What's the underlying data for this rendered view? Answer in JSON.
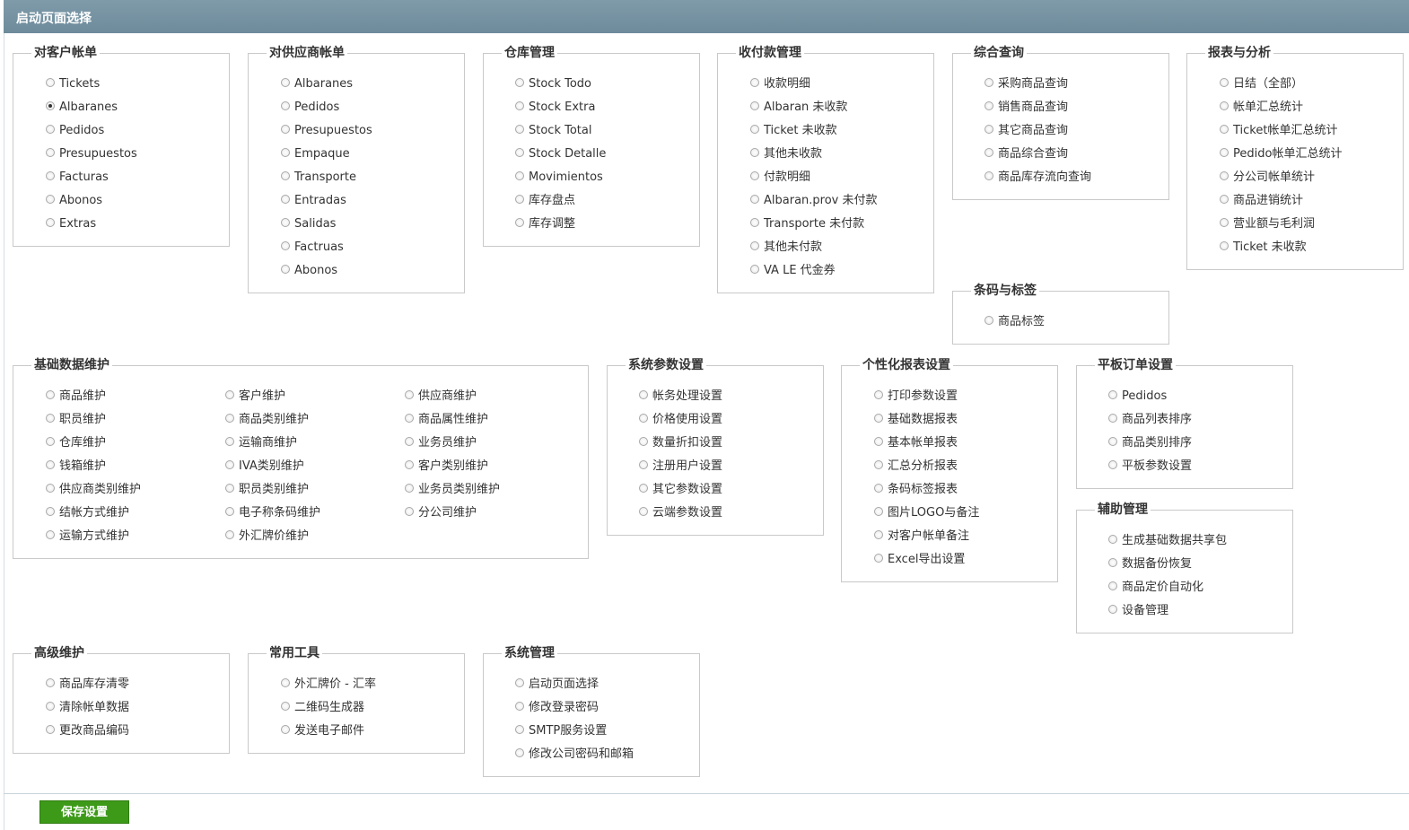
{
  "page": {
    "title": "启动页面选择"
  },
  "groups": [
    {
      "title": "对客户帐单",
      "columns": [
        [
          "Tickets",
          "Albaranes",
          "Pedidos",
          "Presupuestos",
          "Facturas",
          "Abonos",
          "Extras"
        ]
      ]
    },
    {
      "title": "对供应商帐单",
      "columns": [
        [
          "Albaranes",
          "Pedidos",
          "Presupuestos",
          "Empaque",
          "Transporte",
          "Entradas",
          "Salidas",
          "Factruas",
          "Abonos"
        ]
      ]
    },
    {
      "title": "仓库管理",
      "columns": [
        [
          "Stock Todo",
          "Stock Extra",
          "Stock Total",
          "Stock Detalle",
          "Movimientos",
          "库存盘点",
          "库存调整"
        ]
      ]
    },
    {
      "title": "收付款管理",
      "columns": [
        [
          "收款明细",
          "Albaran 未收款",
          "Ticket 未收款",
          "其他未收款",
          "付款明细",
          "Albaran.prov 未付款",
          "Transporte 未付款",
          "其他未付款",
          "VA LE 代金券"
        ]
      ]
    },
    {
      "title": "综合查询",
      "columns": [
        [
          "采购商品查询",
          "销售商品查询",
          "其它商品查询",
          "商品综合查询",
          "商品库存流向查询"
        ]
      ]
    },
    {
      "title": "报表与分析",
      "columns": [
        [
          "日结（全部）",
          "帐单汇总统计",
          "Ticket帐单汇总统计",
          "Pedido帐单汇总统计",
          "分公司帐单统计",
          "商品进销统计",
          "营业额与毛利润",
          "Ticket 未收款"
        ]
      ]
    },
    {
      "title": "条码与标签",
      "columns": [
        [
          "商品标签"
        ]
      ]
    },
    {
      "title": "基础数据维护",
      "columns": [
        [
          "商品维护",
          "职员维护",
          "仓库维护",
          "钱箱维护",
          "供应商类别维护",
          "结帐方式维护",
          "运输方式维护"
        ],
        [
          "客户维护",
          "商品类别维护",
          "运输商维护",
          "IVA类别维护",
          "职员类别维护",
          "电子称条码维护",
          "外汇牌价维护"
        ],
        [
          "供应商维护",
          "商品属性维护",
          "业务员维护",
          "客户类别维护",
          "业务员类别维护",
          "分公司维护"
        ]
      ]
    },
    {
      "title": "系统参数设置",
      "columns": [
        [
          "帐务处理设置",
          "价格使用设置",
          "数量折扣设置",
          "注册用户设置",
          "其它参数设置",
          "云端参数设置"
        ]
      ]
    },
    {
      "title": "个性化报表设置",
      "columns": [
        [
          "打印参数设置",
          "基础数据报表",
          "基本帐单报表",
          "汇总分析报表",
          "条码标签报表",
          "图片LOGO与备注",
          "对客户帐单备注",
          "Excel导出设置"
        ]
      ]
    },
    {
      "title": "平板订单设置",
      "columns": [
        [
          "Pedidos",
          "商品列表排序",
          "商品类别排序",
          "平板参数设置"
        ]
      ]
    },
    {
      "title": "辅助管理",
      "columns": [
        [
          "生成基础数据共享包",
          "数据备份恢复",
          "商品定价自动化",
          "设备管理"
        ]
      ]
    },
    {
      "title": "高级维护",
      "columns": [
        [
          "商品库存清零",
          "清除帐单数据",
          "更改商品编码"
        ]
      ]
    },
    {
      "title": "常用工具",
      "columns": [
        [
          "外汇牌价 - 汇率",
          "二维码生成器",
          "发送电子邮件"
        ]
      ]
    },
    {
      "title": "系统管理",
      "columns": [
        [
          "启动页面选择",
          "修改登录密码",
          "SMTP服务设置",
          "修改公司密码和邮箱"
        ]
      ]
    }
  ],
  "selected": {
    "group": 0,
    "column": 0,
    "option": 1
  },
  "actions": {
    "save_label": "保存设置"
  },
  "colors": {
    "title_bar": "#7190a0",
    "save_button": "#3d9a18"
  }
}
